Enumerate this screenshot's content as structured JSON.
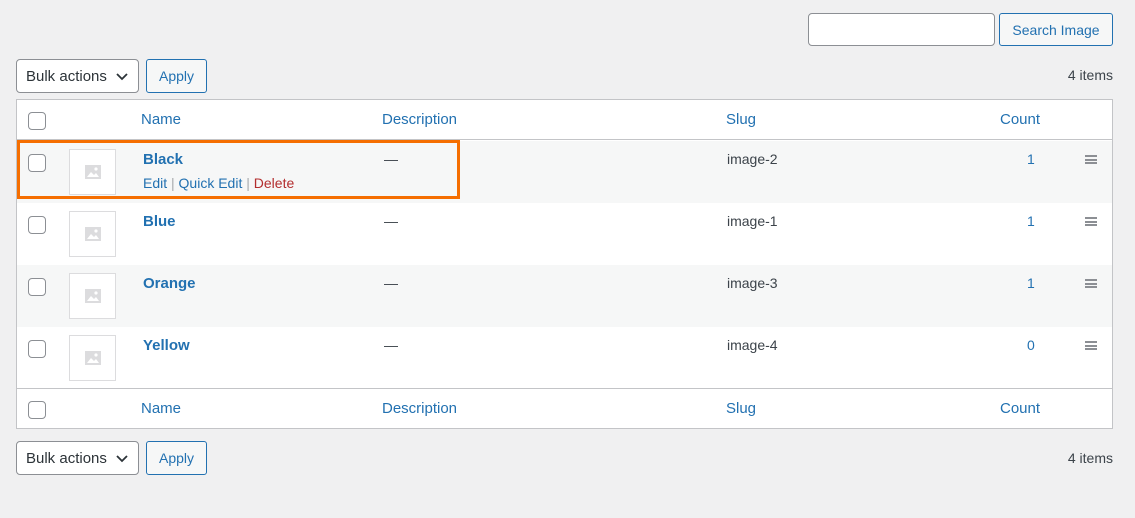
{
  "search": {
    "value": "",
    "placeholder": "",
    "button_label": "Search Image"
  },
  "bulk_actions": {
    "selected": "Bulk actions",
    "apply_label": "Apply"
  },
  "item_count": "4 items",
  "columns": {
    "name": "Name",
    "description": "Description",
    "slug": "Slug",
    "count": "Count"
  },
  "rows": [
    {
      "name": "Black",
      "description": "—",
      "slug": "image-2",
      "count": "1",
      "hovered": true
    },
    {
      "name": "Blue",
      "description": "—",
      "slug": "image-1",
      "count": "1"
    },
    {
      "name": "Orange",
      "description": "—",
      "slug": "image-3",
      "count": "1"
    },
    {
      "name": "Yellow",
      "description": "—",
      "slug": "image-4",
      "count": "0"
    }
  ],
  "row_actions": {
    "edit": "Edit",
    "quick_edit": "Quick Edit",
    "delete": "Delete",
    "separator": "|"
  },
  "colors": {
    "link": "#2271b1",
    "delete": "#b32d2e",
    "highlight": "#f56e00",
    "background": "#f0f0f1"
  }
}
